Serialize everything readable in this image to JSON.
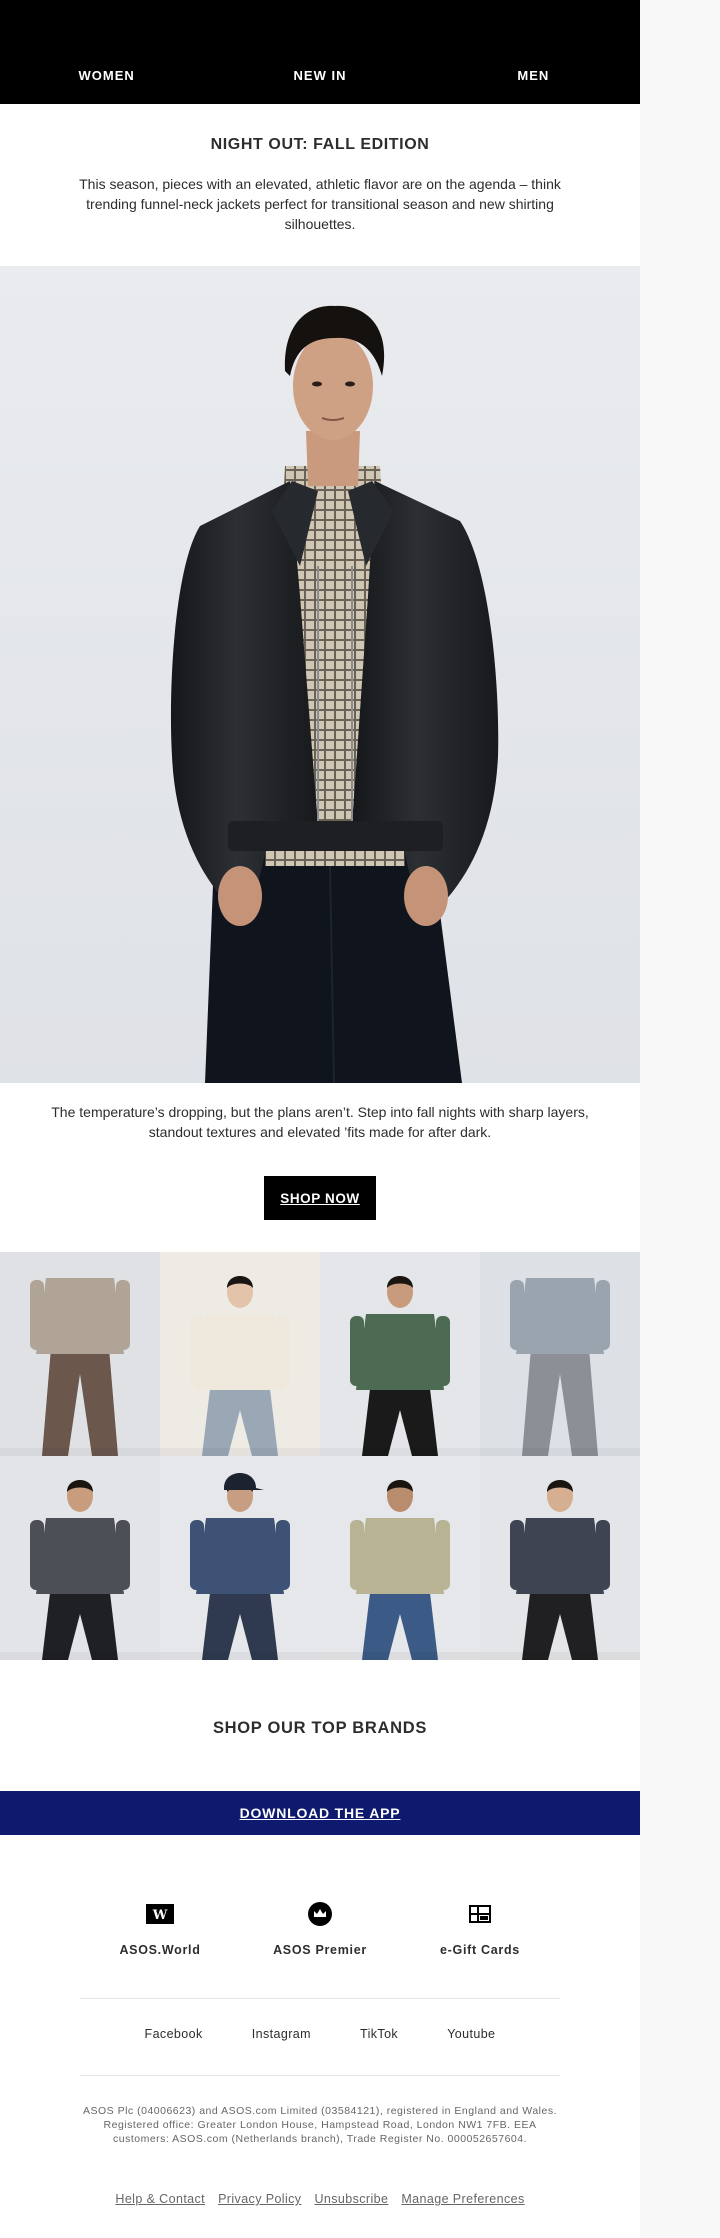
{
  "nav": [
    "WOMEN",
    "NEW IN",
    "MEN"
  ],
  "headline": "NIGHT OUT: FALL EDITION",
  "intro": "This season, pieces with an elevated, athletic flavor are on the agenda – think trending funnel-neck jackets perfect for transitional season and new shirting silhouettes.",
  "hero": {
    "alt": "Model in black leather jacket and plaid shirt"
  },
  "body": "The temperature’s dropping, but the plans aren’t. Step into fall nights with sharp layers, standout textures and elevated ’fits made for after dark.",
  "cta": "SHOP NOW",
  "grid": [
    {
      "bg": "#dfe1e5",
      "skin": "#6b4a36",
      "top": "#b0a497",
      "bottom": "#6b574c",
      "hat": ""
    },
    {
      "bg": "#eeeae4",
      "skin": "#e3c3aa",
      "top": "#efe8dc",
      "bottom": "#9aa8b6",
      "hat": ""
    },
    {
      "bg": "#e4e6ea",
      "skin": "#c79b7c",
      "top": "#4d6b52",
      "bottom": "#1a1a1a",
      "hat": ""
    },
    {
      "bg": "#dde1e5",
      "skin": "#c99f83",
      "top": "#9aa4ae",
      "bottom": "#8c9096",
      "hat": ""
    },
    {
      "bg": "#e2e4e8",
      "skin": "#c89c7c",
      "top": "#4c4f55",
      "bottom": "#1f2024",
      "hat": ""
    },
    {
      "bg": "#e5e7ea",
      "skin": "#c79e82",
      "top": "#3d5275",
      "bottom": "#2f3a50",
      "hat": "#1d2230"
    },
    {
      "bg": "#e6e7ea",
      "skin": "#b88c6c",
      "top": "#b7b394",
      "bottom": "#3b5a85",
      "hat": ""
    },
    {
      "bg": "#e3e5e8",
      "skin": "#d6ae92",
      "top": "#3f4452",
      "bottom": "#202022",
      "hat": ""
    }
  ],
  "brands": "SHOP OUR TOP BRANDS",
  "app": "DOWNLOAD THE APP",
  "features": [
    {
      "label": "ASOS.World",
      "icon": "asos-world-icon",
      "glyph": "W"
    },
    {
      "label": "ASOS Premier",
      "icon": "premier-crown-icon"
    },
    {
      "label": "e-Gift Cards",
      "icon": "gift-card-icon"
    }
  ],
  "social": [
    "Facebook",
    "Instagram",
    "TikTok",
    "Youtube"
  ],
  "legal": "ASOS Plc (04006623) and ASOS.com Limited (03584121), registered in England and Wales. Registered office: Greater London House, Hampstead Road, London NW1 7FB. EEA customers: ASOS.com (Netherlands branch), Trade Register No. 000052657604.",
  "footer_links": [
    "Help & Contact",
    "Privacy Policy",
    "Unsubscribe",
    "Manage Preferences"
  ]
}
